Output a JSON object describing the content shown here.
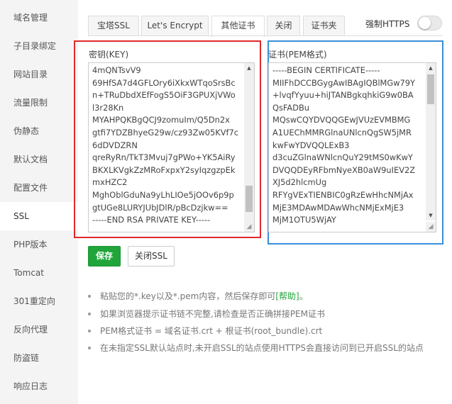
{
  "sidebar": {
    "items": [
      {
        "label": "域名管理"
      },
      {
        "label": "子目录绑定"
      },
      {
        "label": "网站目录"
      },
      {
        "label": "流量限制"
      },
      {
        "label": "伪静态"
      },
      {
        "label": "默认文档"
      },
      {
        "label": "配置文件"
      },
      {
        "label": "SSL"
      },
      {
        "label": "PHP版本"
      },
      {
        "label": "Tomcat"
      },
      {
        "label": "301重定向"
      },
      {
        "label": "反向代理"
      },
      {
        "label": "防盗链"
      },
      {
        "label": "响应日志"
      }
    ],
    "active": "SSL"
  },
  "tabs": [
    {
      "label": "宝塔SSL"
    },
    {
      "label": "Let's Encrypt"
    },
    {
      "label": "其他证书"
    },
    {
      "label": "关闭"
    },
    {
      "label": "证书夹"
    }
  ],
  "active_tab": "其他证书",
  "https_toggle": {
    "label": "强制HTTPS",
    "on": false
  },
  "key_field": {
    "label": "密钥(KEY)",
    "lines": [
      "4mQNTsvV9",
      "69HfSA7d4GFLOry6iXkxWTqoSrsBc",
      "n+TRuDbdXEfFogS5OiF3GPUXjVWo",
      "l3r28Kn",
      "MYAHPQKBgQCJ9zomuIm/Q5Dn2x",
      "gtfi7YDZBhyeG29w/cz93Zw05KVf7c",
      "6dDVDZRN",
      "qreRyRn/TkT3Mvuj7gPWo+YK5AiRy",
      "BKXLKVgkZzMRoFxpxY2syIqzgzpEk",
      "mxHZC2",
      "MghOblGduNa9yLhLIOe5jOOv6p9p",
      "gtUGe8LURYJUbJDlR/pBcDzjkw==",
      "-----END RSA PRIVATE KEY-----"
    ]
  },
  "cert_field": {
    "label": "证书(PEM格式)",
    "lines": [
      "-----BEGIN CERTIFICATE-----",
      "MIIFhDCCBGygAwIBAgIQBlMGw79Y",
      "+lvqfYyuu+hiJTANBgkqhkiG9w0BA",
      "QsFADBu",
      "MQswCQYDVQQGEwJVUzEVMBMG",
      "A1UEChMMRGlnaUNlcnQgSW5jMR",
      "kwFwYDVQQLExB3",
      "d3cuZGlnaWNlcnQuY29tMS0wKwY",
      "DVQQDEyRFbmNyeXB0aW9uIEV2Z",
      "XJ5d2hlcmUg",
      "RFYgVExTIENBIC0gRzEwHhcNMjAx",
      "MjE3MDAwMDAwWhcNMjExMjE3",
      "MjM1OTU5WjAY"
    ]
  },
  "buttons": {
    "save": "保存",
    "close_ssl": "关闭SSL"
  },
  "notes": [
    {
      "text": "粘贴您的*.key以及*.pem内容，然后保存即可",
      "help": "[帮助]",
      "tail": "。"
    },
    {
      "text": "如果浏览器提示证书链不完整,请检查是否正确拼接PEM证书"
    },
    {
      "text": "PEM格式证书 = 域名证书.crt + 根证书(root_bundle).crt"
    },
    {
      "text": "在未指定SSL默认站点时,未开启SSL的站点使用HTTPS会直接访问到已开启SSL的站点"
    }
  ],
  "colors": {
    "accent_green": "#20a53a",
    "highlight_red": "#e0292b",
    "highlight_blue": "#3b8fd9",
    "sidebar_bg": "#f4f4f4"
  }
}
